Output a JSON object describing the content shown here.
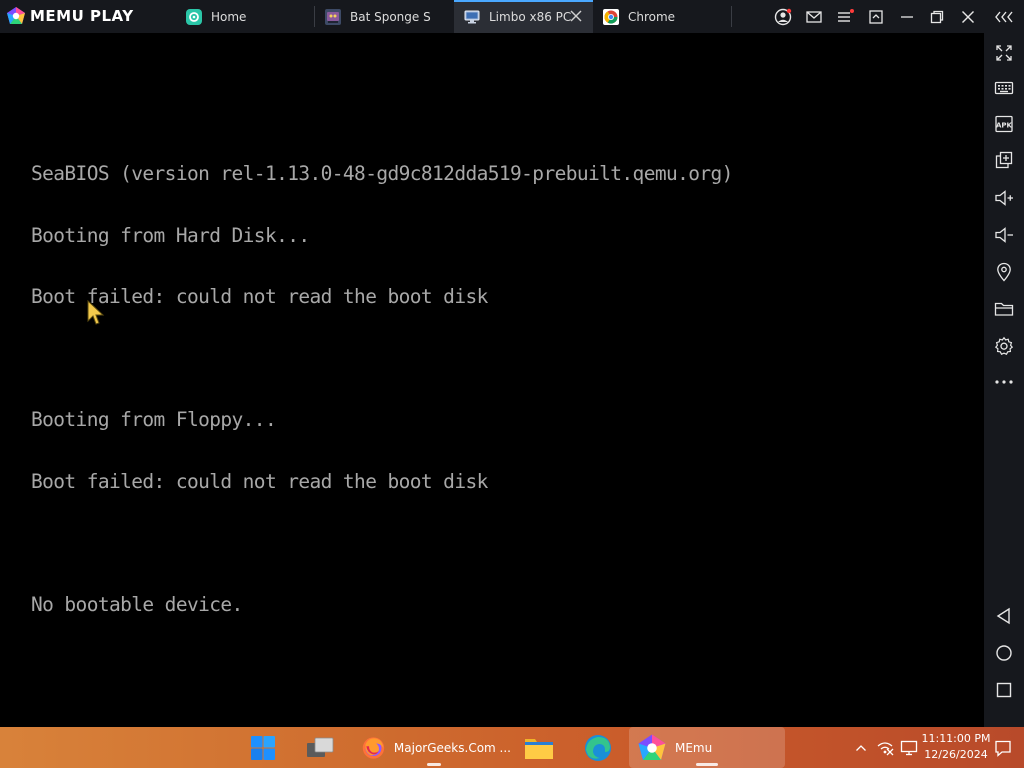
{
  "app": {
    "brand": "MEMU PLAY",
    "tabs": [
      {
        "label": "Home",
        "icon": "home-tab-icon",
        "active": false
      },
      {
        "label": "Bat Sponge S",
        "icon": "game-app-icon",
        "active": false
      },
      {
        "label": "Limbo x86 PC",
        "icon": "pc-monitor-icon",
        "active": true
      },
      {
        "label": "Chrome",
        "icon": "chrome-icon",
        "active": false
      }
    ],
    "window_controls": [
      "account-icon",
      "mail-icon",
      "menu-icon",
      "screen-icon",
      "minimize-icon",
      "restore-icon",
      "close-icon",
      "collapse-icon"
    ],
    "accent_color": "#4aa8ff",
    "titlebar_color": "#16181d"
  },
  "screen": {
    "lines": [
      "SeaBIOS (version rel-1.13.0-48-gd9c812dda519-prebuilt.qemu.org)",
      "Booting from Hard Disk...",
      "Boot failed: could not read the boot disk",
      "",
      "Booting from Floppy...",
      "Boot failed: could not read the boot disk",
      "",
      "No bootable device."
    ],
    "text_color": "#a8a8a8"
  },
  "sidebar": {
    "tools": [
      "fullscreen-icon",
      "keyboard-icon",
      "apk-icon",
      "add-window-icon",
      "volume-up-icon",
      "volume-down-icon",
      "location-icon",
      "folder-icon",
      "settings-icon",
      "more-icon"
    ],
    "nav": [
      "back-icon",
      "home-icon",
      "recents-icon"
    ],
    "apk_label": "APK"
  },
  "taskbar": {
    "items": [
      {
        "name": "start-button",
        "label": ""
      },
      {
        "name": "task-view",
        "label": ""
      },
      {
        "name": "firefox",
        "label": "MajorGeeks.Com ..."
      },
      {
        "name": "file-explorer",
        "label": ""
      },
      {
        "name": "edge",
        "label": ""
      },
      {
        "name": "memu",
        "label": "MEmu"
      }
    ],
    "time": "11:11:00 PM",
    "date": "12/26/2024"
  }
}
